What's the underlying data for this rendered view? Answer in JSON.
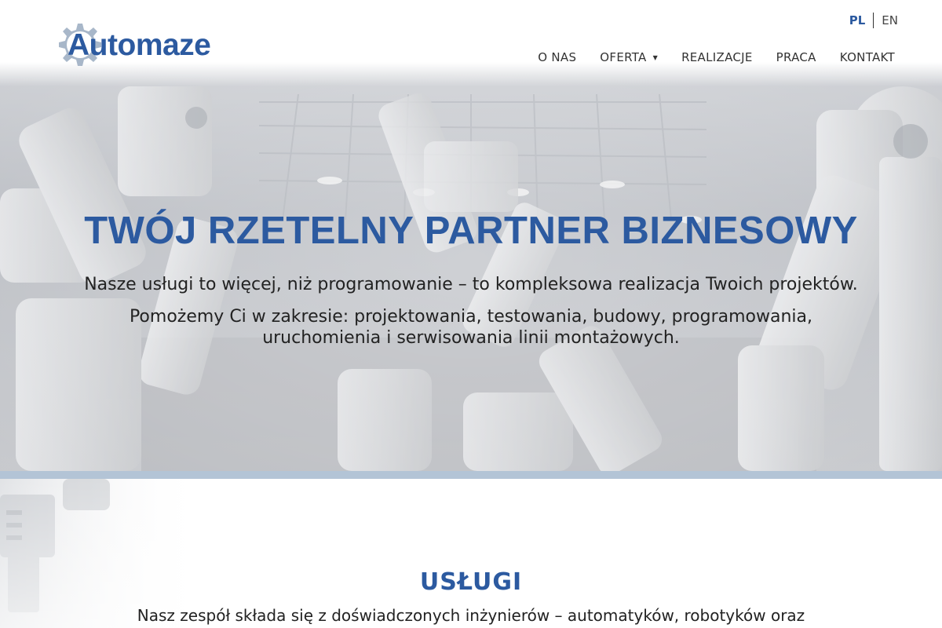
{
  "brand": {
    "logo_part1": "Auto",
    "logo_part2": "maze",
    "primary_color": "#2c5aa0",
    "gear_color": "#a8b7c9"
  },
  "language": {
    "active": "PL",
    "other": "EN"
  },
  "nav": {
    "items": [
      {
        "label": "O NAS"
      },
      {
        "label": "OFERTA",
        "has_dropdown": true
      },
      {
        "label": "REALIZACJE"
      },
      {
        "label": "PRACA"
      },
      {
        "label": "KONTAKT"
      }
    ]
  },
  "hero": {
    "title": "TWÓJ RZETELNY PARTNER BIZNESOWY",
    "line1": "Nasze usługi to więcej, niż programowanie – to kompleksowa realizacja Twoich projektów.",
    "line2": "Pomożemy Ci w zakresie: projektowania, testowania, budowy, programowania, uruchomienia i serwisowania linii montażowych."
  },
  "services": {
    "title": "USŁUGI",
    "text": "Nasz zespół składa się z doświadczonych inżynierów – automatyków, robotyków oraz"
  }
}
